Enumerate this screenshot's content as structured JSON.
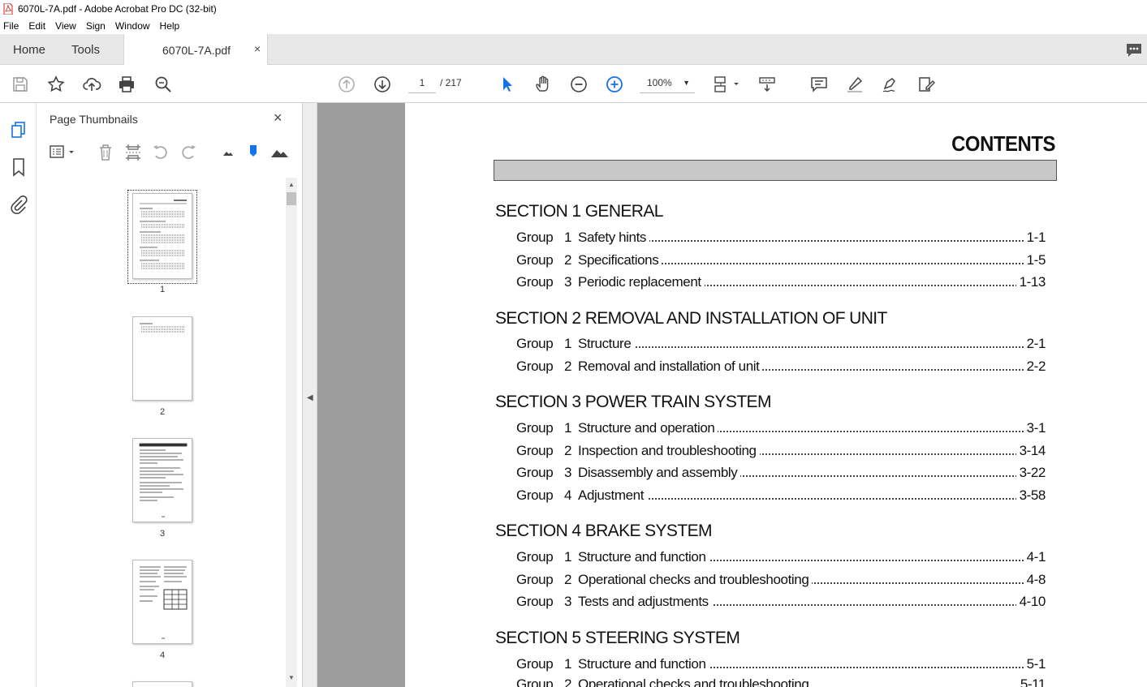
{
  "window": {
    "title": "6070L-7A.pdf - Adobe Acrobat Pro DC (32-bit)"
  },
  "menu": [
    "File",
    "Edit",
    "View",
    "Sign",
    "Window",
    "Help"
  ],
  "tabs": {
    "home": "Home",
    "tools": "Tools",
    "doc": "6070L-7A.pdf",
    "doc_close": "×"
  },
  "toolbar": {
    "page_current": "1",
    "page_total": "/ 217",
    "zoom": "100%"
  },
  "panel": {
    "title": "Page Thumbnails",
    "close": "×"
  },
  "thumbnails": [
    {
      "label": "1"
    },
    {
      "label": "2"
    },
    {
      "label": "3"
    },
    {
      "label": "4"
    }
  ],
  "colors": {
    "accent_blue": "#1473e6",
    "tab_bar": "#e8e8e8",
    "viewer_bg": "#9c9c9c",
    "pdf_red": "#d9241c"
  },
  "document": {
    "title": "CONTENTS",
    "sections": [
      {
        "heading": "SECTION 1  GENERAL",
        "entries": [
          {
            "group": "Group",
            "num": "1",
            "text": "Safety hints",
            "page": "1-1"
          },
          {
            "group": "Group",
            "num": "2",
            "text": "Specifications",
            "page": "1-5"
          },
          {
            "group": "Group",
            "num": "3",
            "text": "Periodic replacement",
            "page": "1-13"
          }
        ]
      },
      {
        "heading": "SECTION 2  REMOVAL AND INSTALLATION OF UNIT",
        "entries": [
          {
            "group": "Group",
            "num": "1",
            "text": "Structure",
            "page": "2-1"
          },
          {
            "group": "Group",
            "num": "2",
            "text": "Removal and installation of unit",
            "page": "2-2"
          }
        ]
      },
      {
        "heading": "SECTION 3  POWER TRAIN SYSTEM",
        "entries": [
          {
            "group": "Group",
            "num": "1",
            "text": "Structure and operation",
            "page": "3-1"
          },
          {
            "group": "Group",
            "num": "2",
            "text": "Inspection and troubleshooting",
            "page": "3-14"
          },
          {
            "group": "Group",
            "num": "3",
            "text": "Disassembly and assembly",
            "page": "3-22"
          },
          {
            "group": "Group",
            "num": "4",
            "text": "Adjustment",
            "page": "3-58"
          }
        ]
      },
      {
        "heading": "SECTION 4  BRAKE SYSTEM",
        "entries": [
          {
            "group": "Group",
            "num": "1",
            "text": "Structure and function",
            "page": "4-1"
          },
          {
            "group": "Group",
            "num": "2",
            "text": "Operational checks and troubleshooting",
            "page": "4-8"
          },
          {
            "group": "Group",
            "num": "3",
            "text": "Tests and adjustments",
            "page": "4-10"
          }
        ]
      },
      {
        "heading": "SECTION 5  STEERING SYSTEM",
        "entries": [
          {
            "group": "Group",
            "num": "1",
            "text": "Structure and function",
            "page": "5-1"
          },
          {
            "group": "Group",
            "num": "2",
            "text": "Operational checks and troubleshooting",
            "page": "5-11"
          }
        ]
      }
    ]
  }
}
